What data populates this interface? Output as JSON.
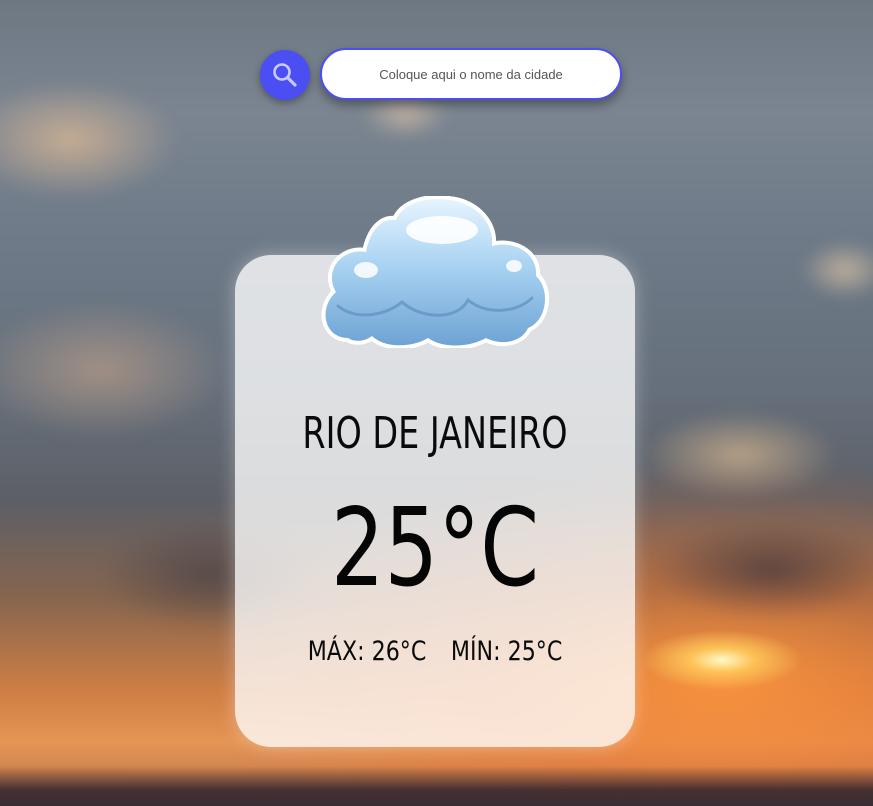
{
  "search": {
    "placeholder": "Coloque aqui o nome da cidade",
    "icon": "search-icon",
    "accent_color": "#4b4ef2"
  },
  "weather": {
    "icon": "cloud-icon",
    "city": "RIO DE JANEIRO",
    "temperature": "25°C",
    "max": "MÁX: 26°C",
    "min": "MÍN: 25°C"
  }
}
